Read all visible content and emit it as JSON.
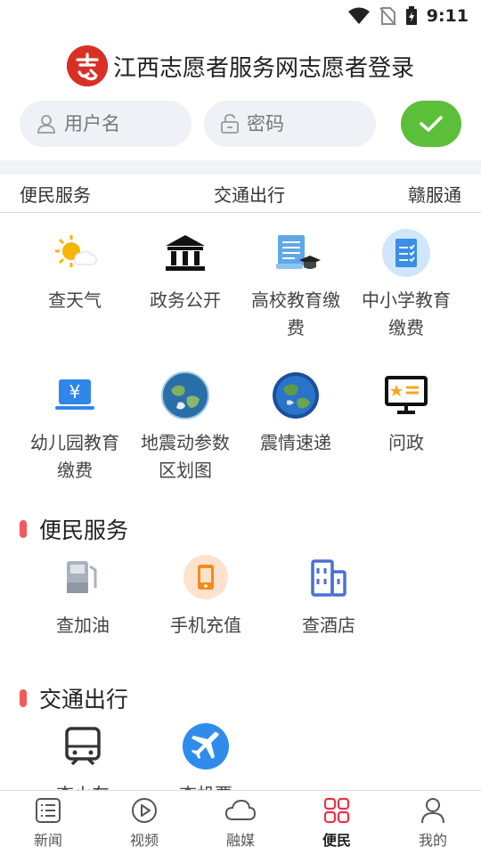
{
  "status": {
    "time": "9:11"
  },
  "header": {
    "title": "江西志愿者服务网志愿者登录",
    "logo_char": "志"
  },
  "login": {
    "username_placeholder": "用户名",
    "password_placeholder": "密码"
  },
  "tabs": [
    "便民服务",
    "交通出行",
    "赣服通"
  ],
  "grid": [
    {
      "label": "查天气",
      "icon": "weather-icon"
    },
    {
      "label": "政务公开",
      "icon": "government-building-icon"
    },
    {
      "label": "高校教育缴费",
      "icon": "university-fee-icon"
    },
    {
      "label": "中小学教育缴费",
      "icon": "school-fee-icon"
    },
    {
      "label": "幼儿园教育缴费",
      "icon": "kindergarten-fee-icon"
    },
    {
      "label": "地震动参数区划图",
      "icon": "earth-icon"
    },
    {
      "label": "震情速递",
      "icon": "globe-icon"
    },
    {
      "label": "问政",
      "icon": "inquiry-board-icon"
    }
  ],
  "sections": [
    {
      "title": "便民服务",
      "items": [
        {
          "label": "查加油",
          "icon": "fuel-icon"
        },
        {
          "label": "手机充值",
          "icon": "phone-recharge-icon"
        },
        {
          "label": "查酒店",
          "icon": "hotel-icon"
        }
      ]
    },
    {
      "title": "交通出行",
      "items": [
        {
          "label": "查火车",
          "icon": "train-icon"
        },
        {
          "label": "查机票",
          "icon": "plane-icon"
        }
      ]
    }
  ],
  "nav": [
    {
      "label": "新闻",
      "icon": "news-icon"
    },
    {
      "label": "视频",
      "icon": "video-icon"
    },
    {
      "label": "融媒",
      "icon": "cloud-icon"
    },
    {
      "label": "便民",
      "icon": "grid-icon",
      "active": true
    },
    {
      "label": "我的",
      "icon": "profile-icon"
    }
  ],
  "colors": {
    "accent": "#e8334a",
    "login_button": "#5cbf3a",
    "section_bar": "#f05a5a"
  }
}
